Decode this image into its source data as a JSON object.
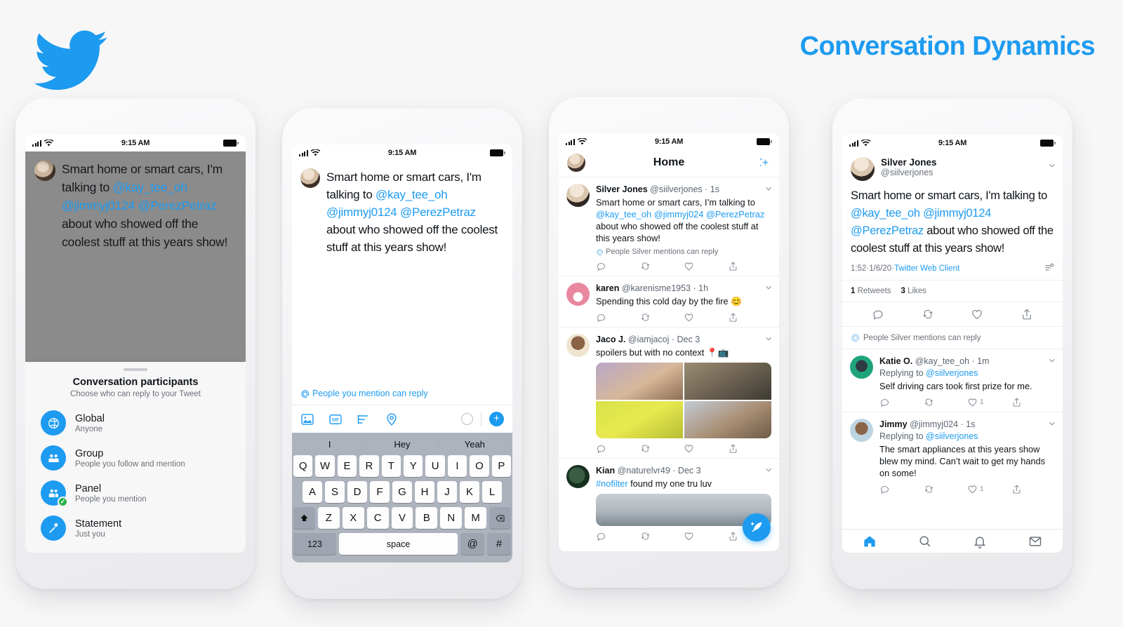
{
  "deck": {
    "title": "Conversation Dynamics",
    "logo_icon": "twitter-bird-icon",
    "accent_color": "#1d9bf0"
  },
  "status_bar": {
    "time": "9:15 AM"
  },
  "phone1": {
    "tweet": {
      "segments": [
        {
          "text": "Smart home or smart cars, I'm talking to ",
          "link": false
        },
        {
          "text": "@kay_tee_oh",
          "link": true
        },
        {
          "text": " ",
          "link": false
        },
        {
          "text": "@jimmyj0124",
          "link": true
        },
        {
          "text": " ",
          "link": false
        },
        {
          "text": "@PerezPetraz",
          "link": true
        },
        {
          "text": " about who showed off the coolest stuff at this years show!",
          "link": false
        }
      ]
    },
    "sheet": {
      "title": "Conversation participants",
      "subtitle": "Choose who can reply to your Tweet",
      "options": [
        {
          "label": "Global",
          "desc": "Anyone",
          "icon": "globe-icon",
          "selected": false
        },
        {
          "label": "Group",
          "desc": "People you follow and mention",
          "icon": "group-icon",
          "selected": false
        },
        {
          "label": "Panel",
          "desc": "People you mention",
          "icon": "panel-icon",
          "selected": true
        },
        {
          "label": "Statement",
          "desc": "Just you",
          "icon": "microphone-icon",
          "selected": false
        }
      ],
      "check_color": "#2bb24c"
    }
  },
  "phone2": {
    "tweet": {
      "segments": [
        {
          "text": "Smart home or smart cars, I'm talking to ",
          "link": false
        },
        {
          "text": "@kay_tee_oh",
          "link": true
        },
        {
          "text": " ",
          "link": false
        },
        {
          "text": "@jimmyj0124",
          "link": true
        },
        {
          "text": " ",
          "link": false
        },
        {
          "text": "@PerezPetraz",
          "link": true
        },
        {
          "text": " about who showed off the coolest stuff at this years show!",
          "link": false
        }
      ]
    },
    "reply_setting": "People you mention can reply",
    "toolbar": {
      "icons": [
        "image-icon",
        "gif-icon",
        "poll-icon",
        "location-icon"
      ],
      "counter": "character-count-ring",
      "add": "add-tweet-button"
    },
    "keyboard": {
      "predictions": [
        "I",
        "Hey",
        "Yeah"
      ],
      "row1": [
        "Q",
        "W",
        "E",
        "R",
        "T",
        "Y",
        "U",
        "I",
        "O",
        "P"
      ],
      "row2": [
        "A",
        "S",
        "D",
        "F",
        "G",
        "H",
        "J",
        "K",
        "L"
      ],
      "row3": [
        "Z",
        "X",
        "C",
        "V",
        "B",
        "N",
        "M"
      ],
      "shift": "shift-key",
      "backspace": "backspace-key",
      "numbers_label": "123",
      "space_label": "space",
      "at_label": "@",
      "hash_label": "#"
    }
  },
  "phone3": {
    "nav_title": "Home",
    "sparkle_icon": "sparkle-icon",
    "tweets": [
      {
        "name": "Silver Jones",
        "handle": "@siilverjones",
        "time": "1s",
        "avatar": "av-silver",
        "segments": [
          {
            "text": "Smart home or smart cars, I’m talking to  ",
            "link": false
          },
          {
            "text": "@kay_tee_oh",
            "link": true
          },
          {
            "text": " ",
            "link": false
          },
          {
            "text": "@jimmyj024",
            "link": true
          },
          {
            "text": " ",
            "link": false
          },
          {
            "text": "@PerezPetraz",
            "link": true
          },
          {
            "text": " about who showed off the coolest stuff at this years show!",
            "link": false
          }
        ],
        "context": "People Silver mentions can reply",
        "media": null,
        "counts": [
          "",
          "",
          "",
          ""
        ]
      },
      {
        "name": "karen",
        "handle": "@karenisme1953",
        "time": "1h",
        "avatar": "av-karen",
        "segments": [
          {
            "text": "Spending this cold day by the fire 😊",
            "link": false
          }
        ],
        "context": null,
        "media": null,
        "counts": [
          "",
          "",
          "",
          ""
        ]
      },
      {
        "name": "Jaco J.",
        "handle": "@iamjacoj",
        "time": "Dec 3",
        "avatar": "av-jaco",
        "segments": [
          {
            "text": "spoilers but with no context 📍📺",
            "link": false
          }
        ],
        "context": null,
        "media": "grid4",
        "counts": [
          "",
          "",
          "",
          ""
        ]
      },
      {
        "name": "Kian",
        "handle": "@naturelvr49",
        "time": "Dec 3",
        "avatar": "av-kian",
        "segments": [
          {
            "text": "#nofilter",
            "link": true
          },
          {
            "text": " found my one tru luv",
            "link": false
          }
        ],
        "context": null,
        "media": "single",
        "counts": [
          "",
          "",
          "",
          ""
        ]
      }
    ],
    "fab": "compose-tweet-button"
  },
  "phone4": {
    "author": {
      "name": "Silver Jones",
      "handle": "@siilverjones",
      "avatar": "av-silver"
    },
    "tweet": {
      "segments": [
        {
          "text": "Smart home or smart cars, I'm talking to ",
          "link": false
        },
        {
          "text": "@kay_tee_oh",
          "link": true
        },
        {
          "text": " ",
          "link": false
        },
        {
          "text": "@jimmyj0124",
          "link": true
        },
        {
          "text": " ",
          "link": false
        },
        {
          "text": "@PerezPetraz",
          "link": true
        },
        {
          "text": " about who showed off the coolest stuff at this years show!",
          "link": false
        }
      ]
    },
    "meta": {
      "time": "1:52",
      "date": "1/6/20",
      "source": "Twitter Web Client",
      "separator": " · "
    },
    "stats": [
      {
        "count": "1",
        "label": "Retweets"
      },
      {
        "count": "3",
        "label": "Likes"
      }
    ],
    "reply_context": "People Silver mentions can reply",
    "replies": [
      {
        "name": "Katie O.",
        "handle": "@kay_tee_oh",
        "time": "1m",
        "avatar": "av-katie",
        "replying_to_label": "Replying to ",
        "replying_to": "@siilverjones",
        "text": "Self driving cars took first prize for me.",
        "like_count": "1"
      },
      {
        "name": "Jimmy",
        "handle": "@jimmyj024",
        "time": "1s",
        "avatar": "av-jimmy",
        "replying_to_label": "Replying to ",
        "replying_to": "@siilverjones",
        "text": "The smart appliances at this years show blew my mind. Can’t wait to get my hands on some!",
        "like_count": "1"
      }
    ],
    "tabbar": [
      {
        "icon": "home-icon",
        "active": true
      },
      {
        "icon": "search-icon",
        "active": false
      },
      {
        "icon": "notifications-icon",
        "active": false
      },
      {
        "icon": "messages-icon",
        "active": false
      }
    ]
  }
}
